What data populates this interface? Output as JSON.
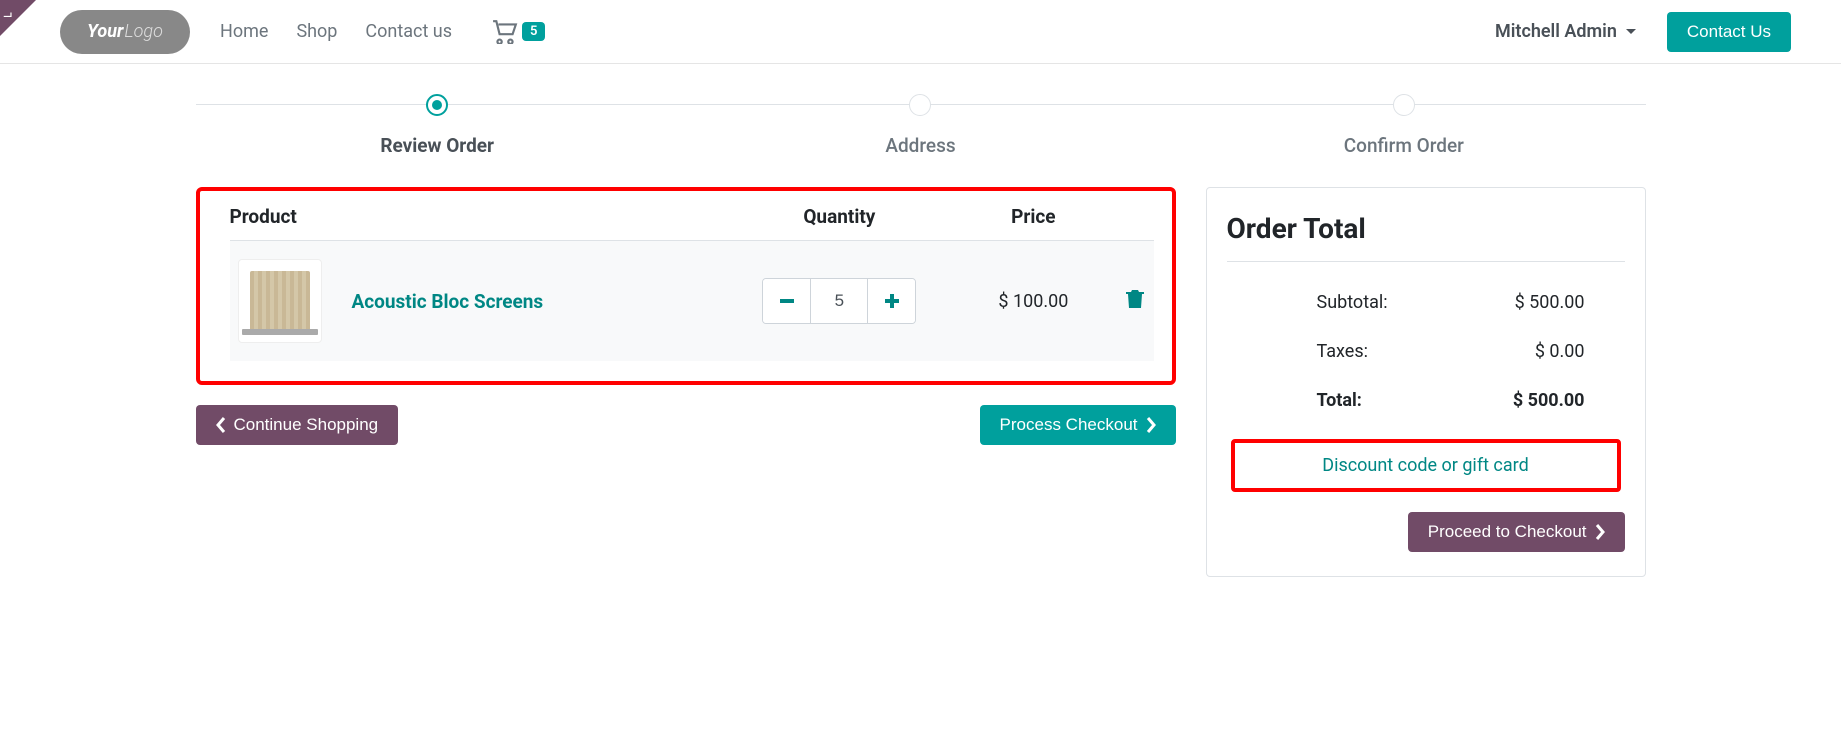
{
  "nav": {
    "links": [
      "Home",
      "Shop",
      "Contact us"
    ],
    "cart_count": "5",
    "user": "Mitchell Admin",
    "contact_btn": "Contact Us"
  },
  "steps": [
    {
      "label": "Review Order",
      "active": true
    },
    {
      "label": "Address",
      "active": false
    },
    {
      "label": "Confirm Order",
      "active": false
    }
  ],
  "cart": {
    "headers": {
      "product": "Product",
      "quantity": "Quantity",
      "price": "Price"
    },
    "items": [
      {
        "name": "Acoustic Bloc Screens",
        "qty": "5",
        "price": "$ 100.00"
      }
    ]
  },
  "actions": {
    "continue": "Continue Shopping",
    "process": "Process Checkout"
  },
  "totals": {
    "title": "Order Total",
    "lines": [
      {
        "label": "Subtotal:",
        "value": "$ 500.00",
        "bold": false
      },
      {
        "label": "Taxes:",
        "value": "$ 0.00",
        "bold": false
      },
      {
        "label": "Total:",
        "value": "$ 500.00",
        "bold": true
      }
    ],
    "discount_label": "Discount code or gift card",
    "proceed_label": "Proceed to Checkout"
  }
}
